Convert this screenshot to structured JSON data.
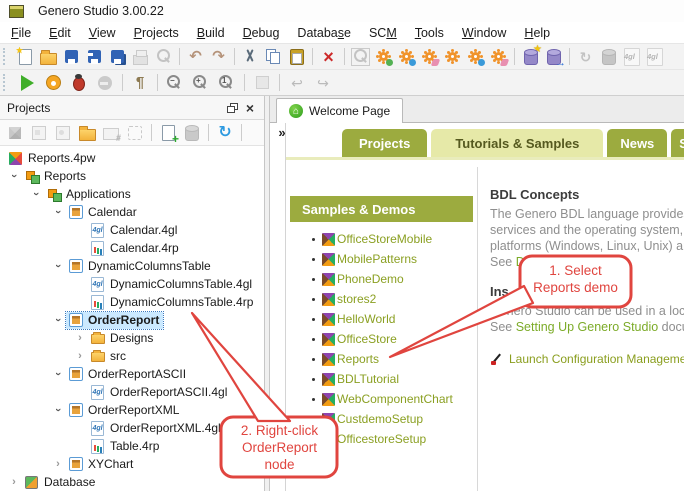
{
  "window": {
    "title": "Genero Studio 3.00.22"
  },
  "menubar": {
    "items": [
      {
        "label": "File",
        "u": 0
      },
      {
        "label": "Edit",
        "u": 0
      },
      {
        "label": "View",
        "u": 0
      },
      {
        "label": "Projects",
        "u": 0
      },
      {
        "label": "Build",
        "u": 0
      },
      {
        "label": "Debug",
        "u": 0
      },
      {
        "label": "Database",
        "u": 6
      },
      {
        "label": "SCM",
        "u": 2
      },
      {
        "label": "Tools",
        "u": 0
      },
      {
        "label": "Window",
        "u": 0
      },
      {
        "label": "Help",
        "u": 0
      }
    ]
  },
  "toolbar_row1": [
    {
      "n": "new-file",
      "k": "pagenew"
    },
    {
      "n": "open-file",
      "k": "folderopen"
    },
    {
      "n": "save",
      "k": "floppy"
    },
    {
      "n": "save-as",
      "k": "floppyas"
    },
    {
      "n": "save-all",
      "k": "floppyall"
    },
    {
      "n": "print",
      "k": "printer",
      "d": 1
    },
    {
      "n": "print-preview",
      "k": "glassdoc",
      "d": 1
    },
    "|",
    {
      "n": "undo",
      "k": "undo"
    },
    {
      "n": "redo",
      "k": "redo"
    },
    "|",
    {
      "n": "cut",
      "k": "cut"
    },
    {
      "n": "copy",
      "k": "copy"
    },
    {
      "n": "paste",
      "k": "paste"
    },
    "|",
    {
      "n": "delete",
      "k": "redx"
    },
    "|",
    {
      "n": "find-in-files",
      "k": "glassbox",
      "d": 1
    },
    {
      "n": "build",
      "k": "gear-green"
    },
    {
      "n": "build-dependencies",
      "k": "gear-blue"
    },
    {
      "n": "clean",
      "k": "gear-erase"
    },
    {
      "n": "build-all",
      "k": "gear-orange"
    },
    {
      "n": "rebuild-all",
      "k": "gear-orangeblue"
    },
    {
      "n": "clean-all",
      "k": "gear-orangeerase"
    },
    "|",
    {
      "n": "new-db-schema",
      "k": "dbstar"
    },
    {
      "n": "import-db-schema",
      "k": "dbarrow"
    },
    "|",
    {
      "n": "refresh-schema",
      "k": "refreshdim",
      "d": 1
    },
    {
      "n": "db-tool",
      "k": "dbdim",
      "d": 1
    },
    {
      "n": "generate-4gl-a",
      "k": "gl4",
      "d": 1
    },
    {
      "n": "generate-4gl-b",
      "k": "gl4",
      "d": 1
    }
  ],
  "toolbar_row2": [
    {
      "n": "run",
      "k": "play"
    },
    {
      "n": "profile",
      "k": "timer"
    },
    {
      "n": "debug",
      "k": "bug"
    },
    {
      "n": "stop",
      "k": "stop",
      "d": 1
    },
    "|",
    {
      "n": "format-marks",
      "k": "pilcrow"
    },
    "|",
    {
      "n": "zoom-out",
      "k": "glassminus"
    },
    {
      "n": "zoom-in",
      "k": "glassplus"
    },
    {
      "n": "zoom-reset",
      "k": "glassone"
    },
    "|",
    {
      "n": "placeholder",
      "k": "graysq",
      "d": 1
    },
    "|",
    {
      "n": "nav-back",
      "k": "navback",
      "d": 1
    },
    {
      "n": "nav-forward",
      "k": "navfwd",
      "d": 1
    }
  ],
  "panel": {
    "title": "Projects",
    "toolbar": [
      {
        "n": "build-project",
        "k": "cubedim",
        "d": 1
      },
      {
        "n": "package-app",
        "k": "boxdim",
        "d": 1
      },
      {
        "n": "package-image",
        "k": "boxdim2",
        "d": 1
      },
      {
        "n": "open-project-folder",
        "k": "folderopen"
      },
      {
        "n": "folder-config",
        "k": "folderhash",
        "d": 1
      },
      {
        "n": "deploy-package",
        "k": "wiredim",
        "d": 1
      },
      "|",
      {
        "n": "new-file-in-project",
        "k": "pageplus"
      },
      {
        "n": "add-db-schema",
        "k": "dbplusdim",
        "d": 1
      },
      "|",
      {
        "n": "sync-project",
        "k": "refreshblue"
      },
      "|",
      {
        "n": "link-tool",
        "k": "linkdim",
        "d": 1
      },
      {
        "n": "more-tools",
        "k": "chevmore"
      }
    ],
    "tree": [
      {
        "label": "Reports.4pw",
        "icon": "proj",
        "exp": "none",
        "ind": 0
      },
      {
        "label": "Reports",
        "icon": "grp",
        "exp": "open",
        "ind": 0
      },
      {
        "label": "Applications",
        "icon": "grp",
        "exp": "open",
        "ind": 1
      },
      {
        "label": "Calendar",
        "icon": "app",
        "exp": "open",
        "ind": 2
      },
      {
        "label": "Calendar.4gl",
        "icon": "gl",
        "exp": "blank",
        "ind": 3
      },
      {
        "label": "Calendar.4rp",
        "icon": "rp",
        "exp": "blank",
        "ind": 3
      },
      {
        "label": "DynamicColumnsTable",
        "icon": "app",
        "exp": "open",
        "ind": 2
      },
      {
        "label": "DynamicColumnsTable.4gl",
        "icon": "gl",
        "exp": "blank",
        "ind": 3
      },
      {
        "label": "DynamicColumnsTable.4rp",
        "icon": "rp",
        "exp": "blank",
        "ind": 3
      },
      {
        "label": "OrderReport",
        "icon": "app",
        "exp": "open",
        "ind": 2,
        "sel": true
      },
      {
        "label": "Designs",
        "icon": "folder",
        "exp": "closed",
        "ind": 3
      },
      {
        "label": "src",
        "icon": "folder",
        "exp": "closed",
        "ind": 3
      },
      {
        "label": "OrderReportASCII",
        "icon": "app",
        "exp": "open",
        "ind": 2
      },
      {
        "label": "OrderReportASCII.4gl",
        "icon": "gl",
        "exp": "blank",
        "ind": 3
      },
      {
        "label": "OrderReportXML",
        "icon": "app",
        "exp": "open",
        "ind": 2
      },
      {
        "label": "OrderReportXML.4gl",
        "icon": "gl",
        "exp": "blank",
        "ind": 3
      },
      {
        "label": "Table.4rp",
        "icon": "rp",
        "exp": "blank",
        "ind": 3
      },
      {
        "label": "XYChart",
        "icon": "app",
        "exp": "closed",
        "ind": 2
      },
      {
        "label": "Database",
        "icon": "db",
        "exp": "closed",
        "ind": 0
      }
    ]
  },
  "doc_tab": {
    "label": "Welcome Page"
  },
  "welcome_tabs": [
    {
      "label": "Projects",
      "active": false
    },
    {
      "label": "Tutorials & Samples",
      "active": true
    },
    {
      "label": "News",
      "active": false
    },
    {
      "label": "S",
      "active": false
    }
  ],
  "samples": {
    "header": "Samples & Demos",
    "items": [
      "OfficeStoreMobile",
      "MobilePatterns",
      "PhoneDemo",
      "stores2",
      "HelloWorld",
      "OfficeStore",
      "Reports",
      "BDLTutorial",
      "WebComponentChart",
      "CustdemoSetup",
      "OfficestoreSetup"
    ]
  },
  "bdl": {
    "heading": "BDL Concepts",
    "lines": [
      "The Genero BDL language provides",
      "services and the operating system,",
      "platforms (Windows, Linux, Unix) an"
    ],
    "see_prefix": "See ",
    "see_link": "D",
    "heading2": "Ins",
    "para2_line1": "Genero Studio can be used in a loc",
    "see2_prefix": "See ",
    "see2_link": "Setting Up Genero Studio",
    "see2_suffix": " docume",
    "launch_link": "Launch Configuration Management"
  },
  "callouts": [
    {
      "lines": [
        "1. Select",
        "Reports demo"
      ]
    },
    {
      "lines": [
        "2. Right-click",
        "OrderReport",
        "node"
      ]
    }
  ],
  "glyphs": {
    "home": "⌂",
    "chevron": "›",
    "chevron_more": "»",
    "multiply": "×",
    "pilcrow": "¶",
    "undo": "↶",
    "redo": "↷",
    "refresh": "↻",
    "nav_back": "↩",
    "nav_fwd": "↪",
    "star": "★",
    "arrow": "→",
    "plus": "+",
    "minus": "−",
    "one": "1",
    "hash": "#",
    "gl4": "4gl"
  },
  "colors": {
    "olive_tab": "#9cab3f",
    "olive_tab_active": "#e6e9a8",
    "link_green": "#7cab28",
    "callout_red": "#e0453f",
    "tree_selection": "#cbe9ff"
  }
}
